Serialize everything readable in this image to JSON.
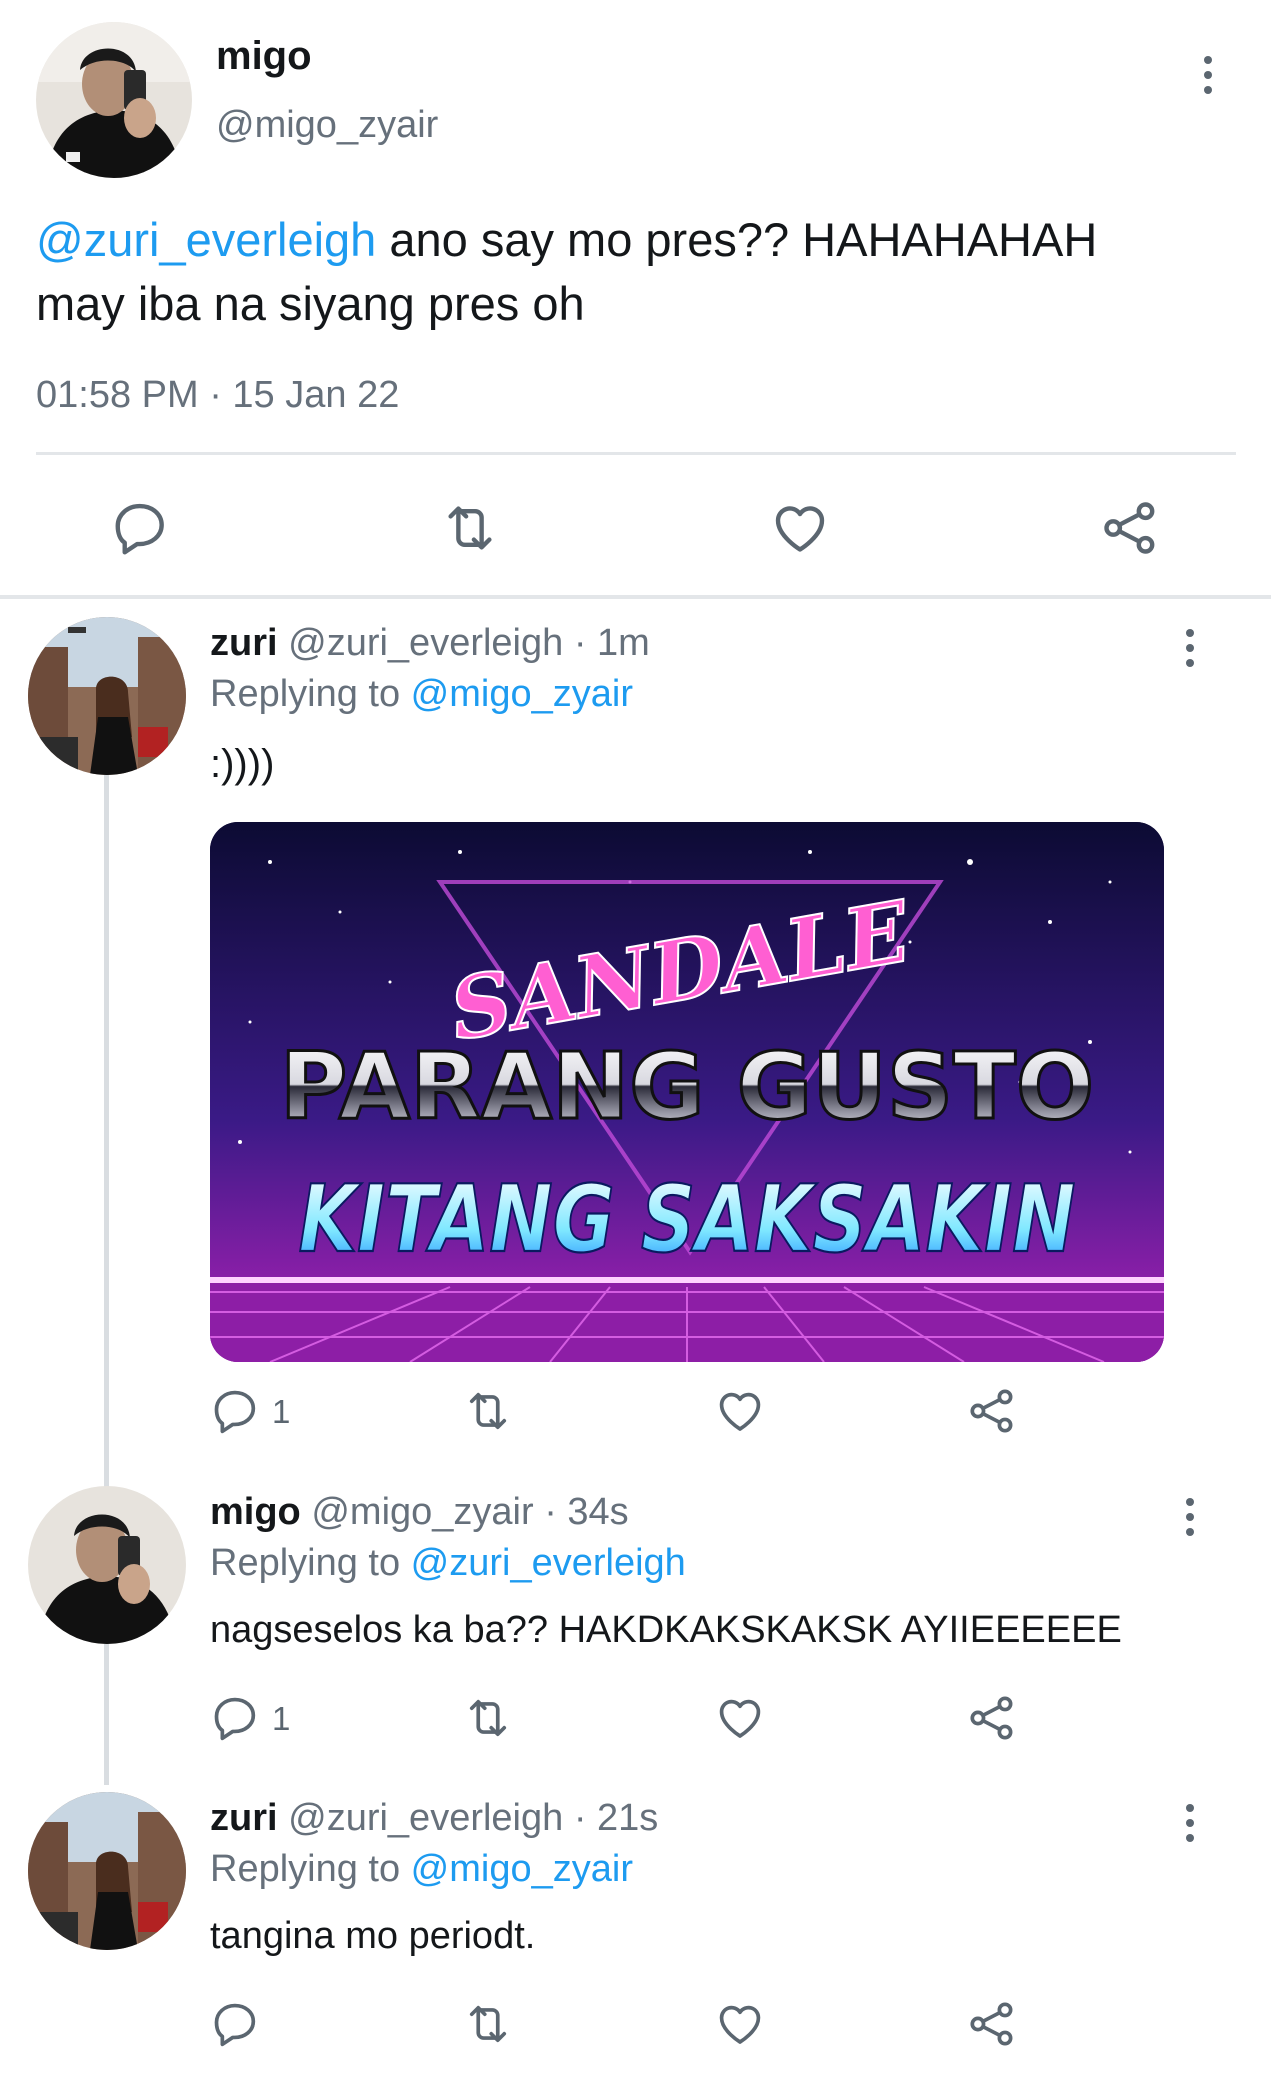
{
  "main_tweet": {
    "display_name": "migo",
    "handle": "@migo_zyair",
    "mention": "@zuri_everleigh",
    "text_line1": " ano say mo pres?? HAHAHAHAH",
    "text_line2": "may iba na siyang pres oh",
    "timestamp": "01:58 PM · 15 Jan 22"
  },
  "replies": [
    {
      "display_name": "zuri",
      "meta": " @zuri_everleigh · 1m",
      "replying_label": "Replying to ",
      "replying_to": "@migo_zyair",
      "text": ":))))",
      "reply_count": "1",
      "media": {
        "line1": "SANDALE",
        "line2": "PARANG GUSTO",
        "line3": "KITANG SAKSAKIN"
      }
    },
    {
      "display_name": "migo",
      "meta": " @migo_zyair · 34s",
      "replying_label": "Replying to ",
      "replying_to": "@zuri_everleigh",
      "text": "nagseselos ka ba?? HAKDKAKSKAKSK AYIIEEEEEE",
      "reply_count": "1"
    },
    {
      "display_name": "zuri",
      "meta": " @zuri_everleigh · 21s",
      "replying_label": "Replying to ",
      "replying_to": "@migo_zyair",
      "text": "tangina mo periodt.",
      "reply_count": ""
    }
  ],
  "icons": [
    "reply-icon",
    "retweet-icon",
    "like-icon",
    "share-icon",
    "more-options-icon"
  ],
  "colors": {
    "link": "#1d9bf0",
    "muted": "#66707b",
    "icon": "#5b6670",
    "divider": "#e3e6e9"
  }
}
